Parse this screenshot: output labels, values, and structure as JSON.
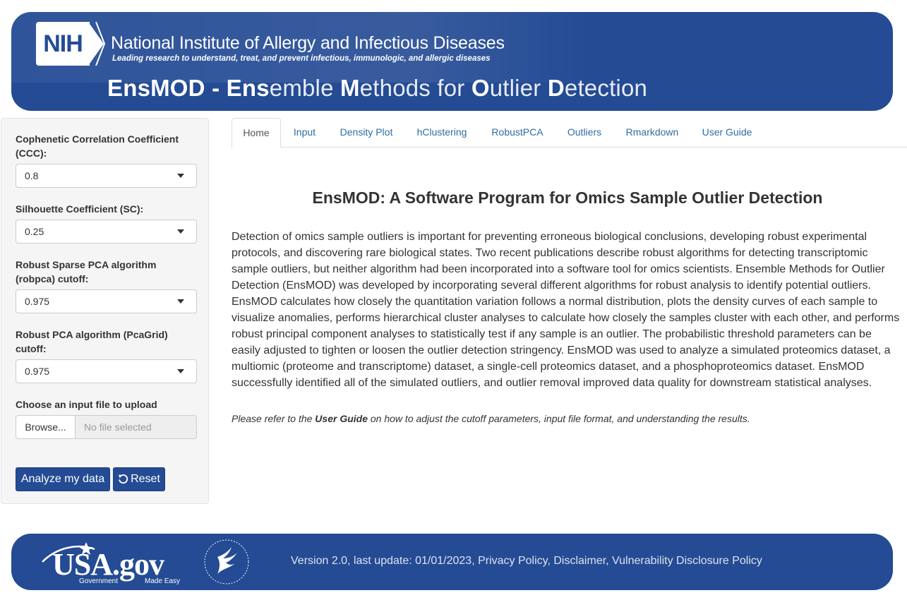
{
  "header": {
    "nih_logo_text": "NIH",
    "institute_name": "National Institute of Allergy and Infectious Diseases",
    "tagline": "Leading research to understand, treat, and prevent infectious, immunologic, and allergic diseases",
    "app_title": {
      "p1": "EnsMOD - ",
      "p2": "Ens",
      "p3": "emble ",
      "p4": "M",
      "p5": "ethods for ",
      "p6": "O",
      "p7": "utlier ",
      "p8": "D",
      "p9": "etection"
    }
  },
  "sidebar": {
    "ccc": {
      "label": "Cophenetic Correlation Coefficient (CCC):",
      "value": "0.8"
    },
    "sc": {
      "label": "Silhouette Coefficient (SC):",
      "value": "0.25"
    },
    "robpca": {
      "label": "Robust Sparse PCA algorithm (robpca) cutoff:",
      "value": "0.975"
    },
    "pcagrid": {
      "label": "Robust PCA algorithm (PcaGrid) cutoff:",
      "value": "0.975"
    },
    "file": {
      "label": "Choose an input file to upload",
      "browse_label": "Browse...",
      "status": "No file selected"
    },
    "analyze_label": "Analyze my data",
    "reset_label": "Reset"
  },
  "tabs": [
    {
      "label": "Home",
      "active": true
    },
    {
      "label": "Input"
    },
    {
      "label": "Density Plot"
    },
    {
      "label": "hClustering"
    },
    {
      "label": "RobustPCA"
    },
    {
      "label": "Outliers"
    },
    {
      "label": "Rmarkdown"
    },
    {
      "label": "User Guide"
    }
  ],
  "main": {
    "title": "EnsMOD: A Software Program for Omics Sample Outlier Detection",
    "body": "Detection of omics sample outliers is important for preventing erroneous biological conclusions, developing robust experimental protocols, and discovering rare biological states. Two recent publications describe robust algorithms for detecting transcriptomic sample outliers, but neither algorithm had been incorporated into a software tool for omics scientists. Ensemble Methods for Outlier Detection (EnsMOD) was developed by incorporating several different algorithms for robust analysis to identify potential outliers. EnsMOD calculates how closely the quantitation variation follows a normal distribution, plots the density curves of each sample to visualize anomalies, performs hierarchical cluster analyses to calculate how closely the samples cluster with each other, and performs robust principal component analyses to statistically test if any sample is an outlier. The probabilistic threshold parameters can be easily adjusted to tighten or loosen the outlier detection stringency. EnsMOD was used to analyze a simulated proteomics dataset, a multiomic (proteome and transcriptome) dataset, a single-cell proteomics dataset, and a phosphoproteomics dataset. EnsMOD successfully identified all of the simulated outliers, and outlier removal improved data quality for downstream statistical analyses.",
    "note_prefix": "Please refer to the ",
    "note_link": "User Guide",
    "note_suffix": " on how to adjust the cutoff parameters, input file format, and understanding the results."
  },
  "footer": {
    "usa_logo_text": "USA.gov",
    "usa_logo_sub1": "Government",
    "usa_logo_sub2": "Made Easy",
    "text": "Version 2.0, last update: 01/01/2023, Privacy Policy, Disclaimer, Vulnerability Disclosure Policy"
  },
  "colors": {
    "brand_blue": "#244b94",
    "link_blue": "#2e6da4",
    "sidebar_bg": "#f5f5f5"
  }
}
